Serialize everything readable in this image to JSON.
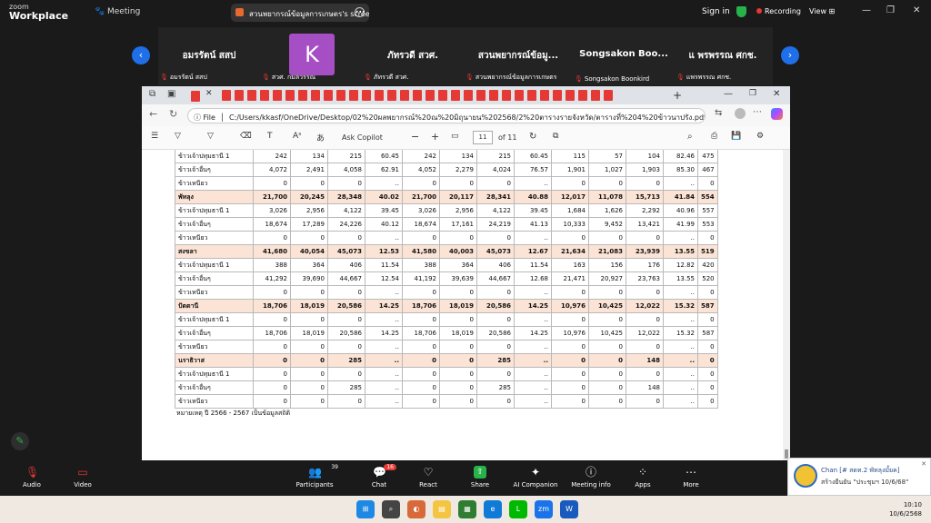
{
  "zoom": {
    "logo_top": "zoom",
    "logo_bottom": "Workplace",
    "meeting_label": "Meeting",
    "share_title": "สวนพยากรณ์ข้อมูลการเกษตร's screen",
    "sign_in": "Sign in",
    "recording": "Recording",
    "view": "View"
  },
  "participants": [
    {
      "name": "อมรรัตน์ สสป",
      "label": "อมรรัตน์ สสป"
    },
    {
      "name": "K",
      "label": "สวศ. กมลวรรณ"
    },
    {
      "name": "ภัทรวดี สวศ.",
      "label": "ภัทรวดี สวศ."
    },
    {
      "name": "สวนพยากรณ์ข้อมู...",
      "label": "สวนพยากรณ์ข้อมูลการเกษตร"
    },
    {
      "name": "Songsakon  Boo...",
      "label": "Songsakon Boonkird"
    },
    {
      "name": "แ พรพรรณ ศกช.",
      "label": "แพรพรรณ ศกช."
    }
  ],
  "browser": {
    "file_label": "File",
    "url": "C:/Users/kkasf/OneDrive/Desktop/02%20ผลพยากรณ์%20ณ%20มิถุนายน%202568/2%20ตารางรายจังหวัด/ตารางที่%204%20ข้าวนาปรัง.pdf",
    "ask_copilot": "Ask Copilot",
    "page_current": "11",
    "page_total": "of 11"
  },
  "table_rows": [
    {
      "type": "sub",
      "label": "ข้าวเจ้าปทุมธานี 1",
      "v": [
        "242",
        "134",
        "215",
        "60.45",
        "242",
        "134",
        "215",
        "60.45",
        "115",
        "57",
        "104",
        "82.46",
        "475"
      ]
    },
    {
      "type": "sub",
      "label": "ข้าวเจ้าอื่นๆ",
      "v": [
        "4,072",
        "2,491",
        "4,058",
        "62.91",
        "4,052",
        "2,279",
        "4,024",
        "76.57",
        "1,901",
        "1,027",
        "1,903",
        "85.30",
        "467"
      ]
    },
    {
      "type": "sub",
      "label": "ข้าวเหนียว",
      "v": [
        "0",
        "0",
        "0",
        "..",
        "0",
        "0",
        "0",
        "..",
        "0",
        "0",
        "0",
        "..",
        "0"
      ]
    },
    {
      "type": "prov",
      "label": "พัทลุง",
      "v": [
        "21,700",
        "20,245",
        "28,348",
        "40.02",
        "21,700",
        "20,117",
        "28,341",
        "40.88",
        "12,017",
        "11,078",
        "15,713",
        "41.84",
        "554"
      ]
    },
    {
      "type": "sub",
      "label": "ข้าวเจ้าปทุมธานี 1",
      "v": [
        "3,026",
        "2,956",
        "4,122",
        "39.45",
        "3,026",
        "2,956",
        "4,122",
        "39.45",
        "1,684",
        "1,626",
        "2,292",
        "40.96",
        "557"
      ]
    },
    {
      "type": "sub",
      "label": "ข้าวเจ้าอื่นๆ",
      "v": [
        "18,674",
        "17,289",
        "24,226",
        "40.12",
        "18,674",
        "17,161",
        "24,219",
        "41.13",
        "10,333",
        "9,452",
        "13,421",
        "41.99",
        "553"
      ]
    },
    {
      "type": "sub",
      "label": "ข้าวเหนียว",
      "v": [
        "0",
        "0",
        "0",
        "..",
        "0",
        "0",
        "0",
        "..",
        "0",
        "0",
        "0",
        "..",
        "0"
      ]
    },
    {
      "type": "prov",
      "label": "สงขลา",
      "v": [
        "41,680",
        "40,054",
        "45,073",
        "12.53",
        "41,580",
        "40,003",
        "45,073",
        "12.67",
        "21,634",
        "21,083",
        "23,939",
        "13.55",
        "519"
      ]
    },
    {
      "type": "sub",
      "label": "ข้าวเจ้าปทุมธานี 1",
      "v": [
        "388",
        "364",
        "406",
        "11.54",
        "388",
        "364",
        "406",
        "11.54",
        "163",
        "156",
        "176",
        "12.82",
        "420"
      ]
    },
    {
      "type": "sub",
      "label": "ข้าวเจ้าอื่นๆ",
      "v": [
        "41,292",
        "39,690",
        "44,667",
        "12.54",
        "41,192",
        "39,639",
        "44,667",
        "12.68",
        "21,471",
        "20,927",
        "23,763",
        "13.55",
        "520"
      ]
    },
    {
      "type": "sub",
      "label": "ข้าวเหนียว",
      "v": [
        "0",
        "0",
        "0",
        "..",
        "0",
        "0",
        "0",
        "..",
        "0",
        "0",
        "0",
        "..",
        "0"
      ]
    },
    {
      "type": "prov",
      "label": "ปัตตานี",
      "v": [
        "18,706",
        "18,019",
        "20,586",
        "14.25",
        "18,706",
        "18,019",
        "20,586",
        "14.25",
        "10,976",
        "10,425",
        "12,022",
        "15.32",
        "587"
      ]
    },
    {
      "type": "sub",
      "label": "ข้าวเจ้าปทุมธานี 1",
      "v": [
        "0",
        "0",
        "0",
        "..",
        "0",
        "0",
        "0",
        "..",
        "0",
        "0",
        "0",
        "..",
        "0"
      ]
    },
    {
      "type": "sub",
      "label": "ข้าวเจ้าอื่นๆ",
      "v": [
        "18,706",
        "18,019",
        "20,586",
        "14.25",
        "18,706",
        "18,019",
        "20,586",
        "14.25",
        "10,976",
        "10,425",
        "12,022",
        "15.32",
        "587"
      ]
    },
    {
      "type": "sub",
      "label": "ข้าวเหนียว",
      "v": [
        "0",
        "0",
        "0",
        "..",
        "0",
        "0",
        "0",
        "..",
        "0",
        "0",
        "0",
        "..",
        "0"
      ]
    },
    {
      "type": "prov",
      "label": "นราธิวาส",
      "v": [
        "0",
        "0",
        "285",
        "..",
        "0",
        "0",
        "285",
        "..",
        "0",
        "0",
        "148",
        "..",
        "0"
      ]
    },
    {
      "type": "sub",
      "label": "ข้าวเจ้าปทุมธานี 1",
      "v": [
        "0",
        "0",
        "0",
        "..",
        "0",
        "0",
        "0",
        "..",
        "0",
        "0",
        "0",
        "..",
        "0"
      ]
    },
    {
      "type": "sub",
      "label": "ข้าวเจ้าอื่นๆ",
      "v": [
        "0",
        "0",
        "285",
        "..",
        "0",
        "0",
        "285",
        "..",
        "0",
        "0",
        "148",
        "..",
        "0"
      ]
    },
    {
      "type": "sub",
      "label": "ข้าวเหนียว",
      "v": [
        "0",
        "0",
        "0",
        "..",
        "0",
        "0",
        "0",
        "..",
        "0",
        "0",
        "0",
        "..",
        "0"
      ]
    }
  ],
  "note": "หมายเหตุ ปี 2566 - 2567 เป็นข้อมูลสถิติ",
  "toolbar": {
    "audio": "Audio",
    "video": "Video",
    "participants": "Participants",
    "participants_count": "39",
    "chat": "Chat",
    "chat_badge": "16",
    "react": "React",
    "share": "Share",
    "ai": "AI Companion",
    "meeting_info": "Meeting info",
    "apps": "Apps",
    "more": "More"
  },
  "notification": {
    "title": "Chan [# สดท.2 พัทลุงมั้ยค]",
    "body": "สร้างยืนยัน \"ประชุมฯ 10/6/68\""
  },
  "clock": {
    "time": "10:10",
    "date": "10/6/2568"
  },
  "colors": {
    "accent": "#1e6fe8",
    "province_row": "#fbe3d5",
    "pdf": "#e53935",
    "avatar": "#a64fc4"
  }
}
